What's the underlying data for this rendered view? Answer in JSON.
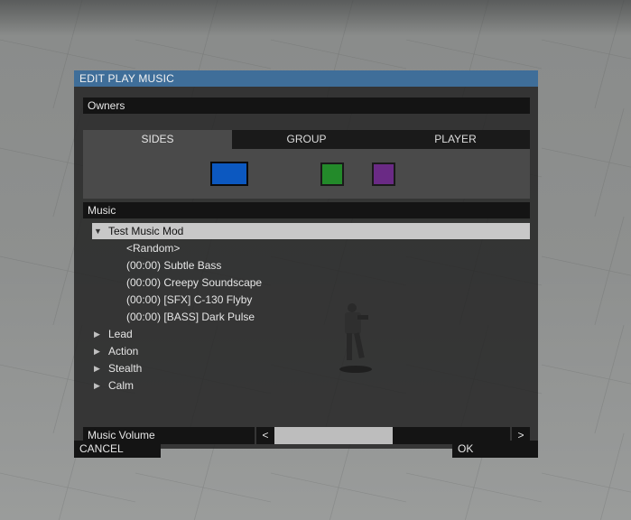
{
  "dialog": {
    "title": "EDIT PLAY MUSIC",
    "owners": {
      "header": "Owners",
      "tabs": [
        "SIDES",
        "GROUP",
        "PLAYER"
      ],
      "active_tab": "SIDES",
      "side_colors": [
        "#0c58c0",
        "#238a2a",
        "#6a2a85"
      ]
    },
    "music": {
      "header": "Music",
      "tree": [
        {
          "label": "Test Music Mod",
          "expanded": true,
          "selected": true
        },
        {
          "label": "<Random>"
        },
        {
          "label": "(00:00) Subtle Bass"
        },
        {
          "label": "(00:00) Creepy Soundscape"
        },
        {
          "label": "(00:00) [SFX] C-130 Flyby"
        },
        {
          "label": "(00:00) [BASS] Dark Pulse"
        },
        {
          "label": "Lead",
          "expanded": false
        },
        {
          "label": "Action",
          "expanded": false
        },
        {
          "label": "Stealth",
          "expanded": false
        },
        {
          "label": "Calm",
          "expanded": false
        }
      ]
    },
    "volume": {
      "label": "Music Volume",
      "decrease": "<",
      "increase": ">",
      "level_fraction": 0.5
    },
    "cancel_label": "CANCEL",
    "ok_label": "OK"
  }
}
